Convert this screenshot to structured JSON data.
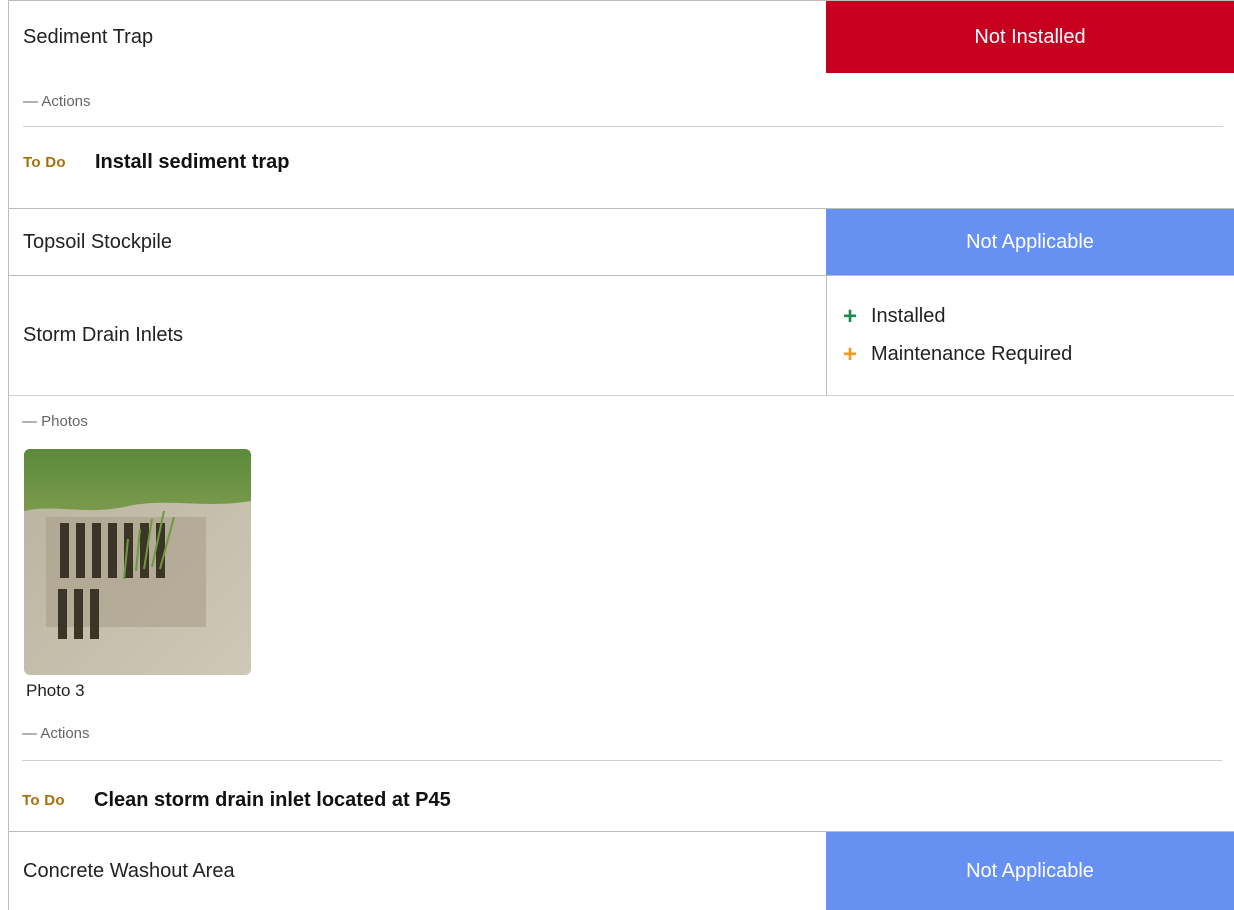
{
  "rows": {
    "sediment_trap": {
      "label": "Sediment Trap",
      "status": "Not Installed",
      "status_color": "#c8001f"
    },
    "topsoil_stockpile": {
      "label": "Topsoil Stockpile",
      "status": "Not Applicable",
      "status_color": "#6690f2"
    },
    "storm_drain_inlets": {
      "label": "Storm Drain Inlets",
      "statuses": [
        {
          "label": "Installed",
          "icon": "plus-icon",
          "color": "#1f8a4c"
        },
        {
          "label": "Maintenance Required",
          "icon": "plus-icon",
          "color": "#f39a1c"
        }
      ]
    },
    "concrete_washout": {
      "label": "Concrete Washout Area",
      "status": "Not Applicable",
      "status_color": "#6690f2"
    }
  },
  "sediment_trap_details": {
    "actions_label": "— Actions",
    "action": {
      "badge": "To Do",
      "text": "Install sediment trap"
    }
  },
  "storm_drain_details": {
    "photos_label": "— Photos",
    "photo_caption": "Photo 3",
    "actions_label": "— Actions",
    "action": {
      "badge": "To Do",
      "text": "Clean storm drain inlet located at P45"
    }
  }
}
